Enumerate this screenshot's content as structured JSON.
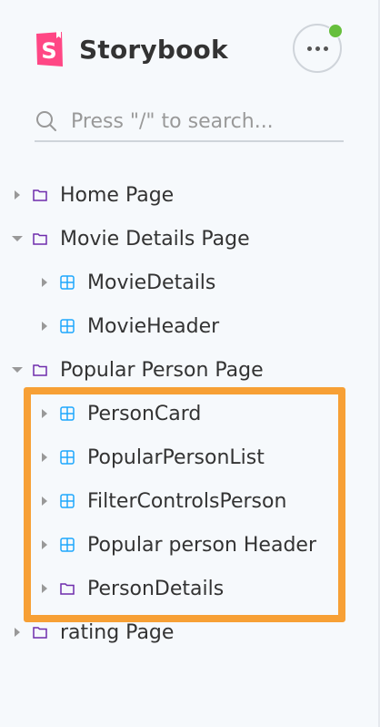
{
  "brand": {
    "title": "Storybook",
    "logo_icon": "storybook-logo-icon",
    "logo_color": "#ff4785"
  },
  "menu": {
    "icon": "ellipsis-icon",
    "notification_color": "#66bf3c"
  },
  "search": {
    "placeholder": "Press \"/\" to search...",
    "value": "",
    "icon": "search-icon"
  },
  "tree": {
    "items": [
      {
        "label": "Home Page",
        "type": "folder",
        "expanded": false,
        "depth": 0
      },
      {
        "label": "Movie Details Page",
        "type": "folder",
        "expanded": true,
        "depth": 0
      },
      {
        "label": "MovieDetails",
        "type": "component",
        "expanded": false,
        "depth": 1
      },
      {
        "label": "MovieHeader",
        "type": "component",
        "expanded": false,
        "depth": 1
      },
      {
        "label": "Popular Person Page",
        "type": "folder",
        "expanded": true,
        "depth": 0
      },
      {
        "label": "PersonCard",
        "type": "component",
        "expanded": false,
        "depth": 1
      },
      {
        "label": "PopularPersonList",
        "type": "component",
        "expanded": false,
        "depth": 1
      },
      {
        "label": "FilterControlsPerson",
        "type": "component",
        "expanded": false,
        "depth": 1
      },
      {
        "label": "Popular person Header",
        "type": "component",
        "expanded": false,
        "depth": 1
      },
      {
        "label": "PersonDetails",
        "type": "folder",
        "expanded": false,
        "depth": 1
      },
      {
        "label": "rating Page",
        "type": "folder",
        "expanded": false,
        "depth": 0
      }
    ]
  },
  "colors": {
    "folder_icon": "#6f2cac",
    "component_icon": "#1ea7fd",
    "highlight": "#f7a035"
  }
}
